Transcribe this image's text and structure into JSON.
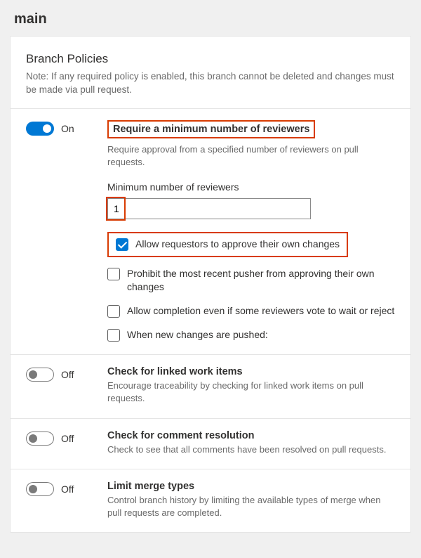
{
  "pageTitle": "main",
  "header": {
    "title": "Branch Policies",
    "note": "Note: If any required policy is enabled, this branch cannot be deleted and changes must be made via pull request."
  },
  "policies": {
    "minReviewers": {
      "toggleOn": "On",
      "title": "Require a minimum number of reviewers",
      "desc": "Require approval from a specified number of reviewers on pull requests.",
      "numLabel": "Minimum number of reviewers",
      "numValue": "1",
      "cb1": "Allow requestors to approve their own changes",
      "cb2": "Prohibit the most recent pusher from approving their own changes",
      "cb3": "Allow completion even if some reviewers vote to wait or reject",
      "cb4": "When new changes are pushed:"
    },
    "linkedWorkItems": {
      "toggleOff": "Off",
      "title": "Check for linked work items",
      "desc": "Encourage traceability by checking for linked work items on pull requests."
    },
    "commentResolution": {
      "toggleOff": "Off",
      "title": "Check for comment resolution",
      "desc": "Check to see that all comments have been resolved on pull requests."
    },
    "limitMergeTypes": {
      "toggleOff": "Off",
      "title": "Limit merge types",
      "desc": "Control branch history by limiting the available types of merge when pull requests are completed."
    }
  }
}
